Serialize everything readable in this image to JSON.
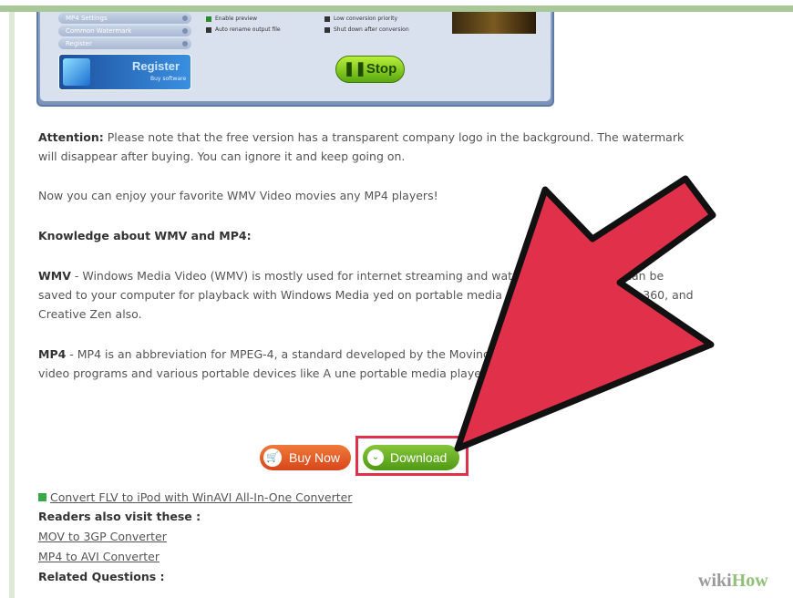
{
  "app": {
    "side_buttons": [
      "MP4 Settings",
      "Common Watermark",
      "Register"
    ],
    "register": {
      "title": "Register",
      "subtitle": "Buy software"
    },
    "options_left": [
      "Enable preview",
      "Auto rename output file"
    ],
    "options_right": [
      "Low conversion priority",
      "Shut down after conversion"
    ],
    "stop_label": "Stop"
  },
  "article": {
    "attention_label": "Attention:",
    "attention_text": " Please note that the free version has a transparent company logo in the background. The watermark will disappear after buying. You can ignore it and keep going on.",
    "enjoy_text": "Now you can enjoy your favorite WMV Video movies any MP4 players!",
    "knowledge_heading": "Knowledge about WMV and MP4:",
    "wmv_label": "WMV",
    "wmv_text": " - Windows Media Video (WMV) is mostly used for internet streaming and watc video format that can be saved to your computer for playback with Windows Media yed on portable media players like Zune, Xbox 360, and Creative Zen also.",
    "mp4_label": "MP4",
    "mp4_text": " - MP4 is an abbreviation for MPEG-4, a standard developed by the Moving P files are supported by many video programs and various portable devices like A une portable media player, etc"
  },
  "buttons": {
    "buy_now": "Buy Now",
    "download": "Download"
  },
  "links": {
    "convert_link": "Convert FLV to iPod with WinAVI All-In-One Converter",
    "readers_heading": "Readers also visit these :",
    "mov_link": "MOV to 3GP Converter",
    "mp4_link": "MP4 to AVI Converter",
    "related_heading": "Related Questions :"
  },
  "watermark": {
    "wiki": "wiki",
    "how": "How"
  },
  "colors": {
    "arrow_red": "#e0304a",
    "download_green": "#5aa81a",
    "buy_orange": "#e0582a",
    "border_green": "#a9c89a"
  }
}
